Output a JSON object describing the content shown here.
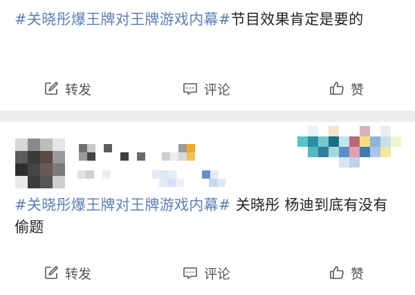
{
  "posts": [
    {
      "hashtag": "#关晓彤爆王牌对王牌游戏内幕#",
      "text": "节目效果肯定是要的",
      "actions": {
        "repost": "转发",
        "comment": "评论",
        "like": "赞"
      }
    },
    {
      "hashtag": "#关晓彤爆王牌对王牌游戏内幕#",
      "text": " 关晓彤 杨迪到底有没有偷题",
      "actions": {
        "repost": "转发",
        "comment": "评论",
        "like": "赞"
      }
    }
  ],
  "icons": {
    "repost": "edit-square-icon",
    "comment": "comment-bubble-icon",
    "like": "thumbs-up-icon"
  },
  "colors": {
    "hashtag": "#5a7fb4",
    "text": "#222222",
    "action_text": "#555555",
    "divider": "#eeeeee"
  }
}
